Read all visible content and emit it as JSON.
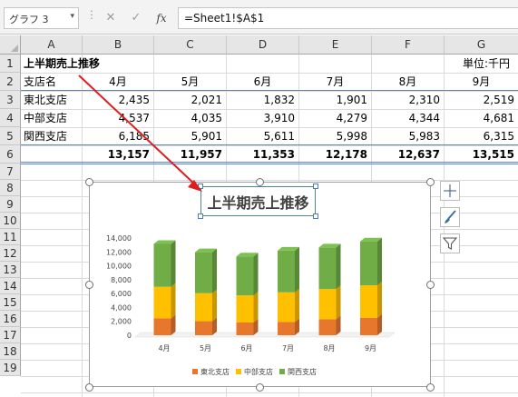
{
  "formula_bar": {
    "name_box": "グラフ 3",
    "cancel_glyph": "✕",
    "enter_glyph": "✓",
    "fx_glyph": "fx",
    "formula": "=Sheet1!$A$1"
  },
  "columns": [
    "A",
    "B",
    "C",
    "D",
    "E",
    "F",
    "G"
  ],
  "rows": [
    "1",
    "2",
    "3",
    "4",
    "5",
    "6",
    "7",
    "8",
    "9",
    "10",
    "11",
    "12",
    "13",
    "14",
    "15",
    "16",
    "17",
    "18",
    "19"
  ],
  "sheet": {
    "title": "上半期売上推移",
    "unit": "単位:千円",
    "header": [
      "支店名",
      "4月",
      "5月",
      "6月",
      "7月",
      "8月",
      "9月"
    ],
    "data_rows": [
      [
        "東北支店",
        "2,435",
        "2,021",
        "1,832",
        "1,901",
        "2,310",
        "2,519"
      ],
      [
        "中部支店",
        "4,537",
        "4,035",
        "3,910",
        "4,279",
        "4,344",
        "4,681"
      ],
      [
        "関西支店",
        "6,185",
        "5,901",
        "5,611",
        "5,998",
        "5,983",
        "6,315"
      ]
    ],
    "total_row": [
      "",
      "13,157",
      "11,957",
      "11,353",
      "12,178",
      "12,637",
      "13,515"
    ]
  },
  "chart_data": {
    "type": "bar",
    "stacked": true,
    "title": "上半期売上推移",
    "categories": [
      "4月",
      "5月",
      "6月",
      "7月",
      "8月",
      "9月"
    ],
    "series": [
      {
        "name": "東北支店",
        "values": [
          2435,
          2021,
          1832,
          1901,
          2310,
          2519
        ],
        "color": "#e8772e"
      },
      {
        "name": "中部支店",
        "values": [
          4537,
          4035,
          3910,
          4279,
          4344,
          4681
        ],
        "color": "#ffc000"
      },
      {
        "name": "関西支店",
        "values": [
          6185,
          5901,
          5611,
          5998,
          5983,
          6315
        ],
        "color": "#70ad47"
      }
    ],
    "ylim": [
      0,
      14000
    ],
    "yticks": [
      "0",
      "2,000",
      "4,000",
      "6,000",
      "8,000",
      "10,000",
      "12,000",
      "14,000"
    ],
    "legend_position": "bottom",
    "grid": false
  },
  "chart_tools": {
    "add_element_icon": "plus-icon",
    "style_icon": "brush-icon",
    "filter_icon": "filter-icon"
  },
  "colors": {
    "arrow": "#d9201f",
    "selection": "#4a7fc1"
  }
}
